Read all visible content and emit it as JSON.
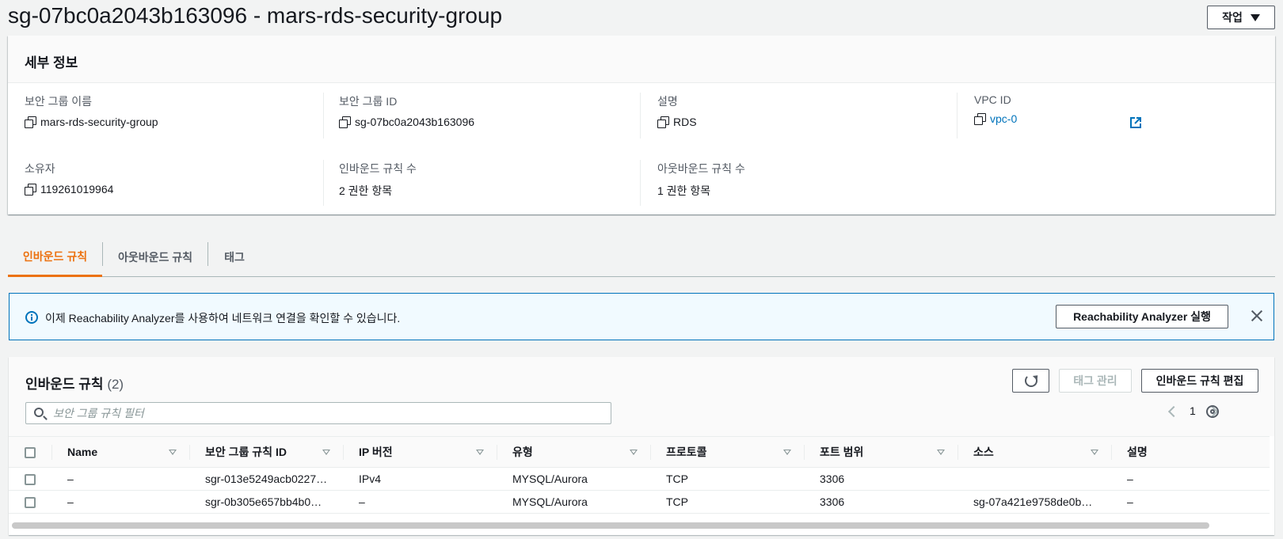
{
  "header": {
    "title": "sg-07bc0a2043b163096 - mars-rds-security-group",
    "actions_label": "작업"
  },
  "details": {
    "heading": "세부 정보",
    "fields": {
      "sg_name": {
        "label": "보안 그룹 이름",
        "value": "mars-rds-security-group"
      },
      "sg_id": {
        "label": "보안 그룹 ID",
        "value": "sg-07bc0a2043b163096"
      },
      "description": {
        "label": "설명",
        "value": "RDS"
      },
      "vpc_id": {
        "label": "VPC ID",
        "value": "vpc-0"
      },
      "owner": {
        "label": "소유자",
        "value": "119261019964"
      },
      "inbound_count": {
        "label": "인바운드 규칙 수",
        "value": "2 권한 항목"
      },
      "outbound_count": {
        "label": "아웃바운드 규칙 수",
        "value": "1 권한 항목"
      }
    }
  },
  "tabs": [
    {
      "label": "인바운드 규칙",
      "active": true
    },
    {
      "label": "아웃바운드 규칙",
      "active": false
    },
    {
      "label": "태그",
      "active": false
    }
  ],
  "flash": {
    "message": "이제 Reachability Analyzer를 사용하여 네트워크 연결을 확인할 수 있습니다.",
    "button_label": "Reachability Analyzer 실행"
  },
  "rules": {
    "title": "인바운드 규칙",
    "count": "(2)",
    "manage_tags_label": "태그 관리",
    "edit_label": "인바운드 규칙 편집",
    "filter_placeholder": "보안 그룹 규칙 필터",
    "page": "1",
    "columns": [
      "Name",
      "보안 그룹 규칙 ID",
      "IP 버전",
      "유형",
      "프로토콜",
      "포트 범위",
      "소스",
      "설명"
    ],
    "rows": [
      [
        "–",
        "sgr-013e5249acb0227…",
        "IPv4",
        "MYSQL/Aurora",
        "TCP",
        "3306",
        "",
        "–"
      ],
      [
        "–",
        "sgr-0b305e657bb4b0…",
        "–",
        "MYSQL/Aurora",
        "TCP",
        "3306",
        "sg-07a421e9758de0b…",
        "–"
      ]
    ]
  },
  "colors": {
    "accent": "#ec7211",
    "link": "#0073bb",
    "info_bg": "#f1faff"
  }
}
